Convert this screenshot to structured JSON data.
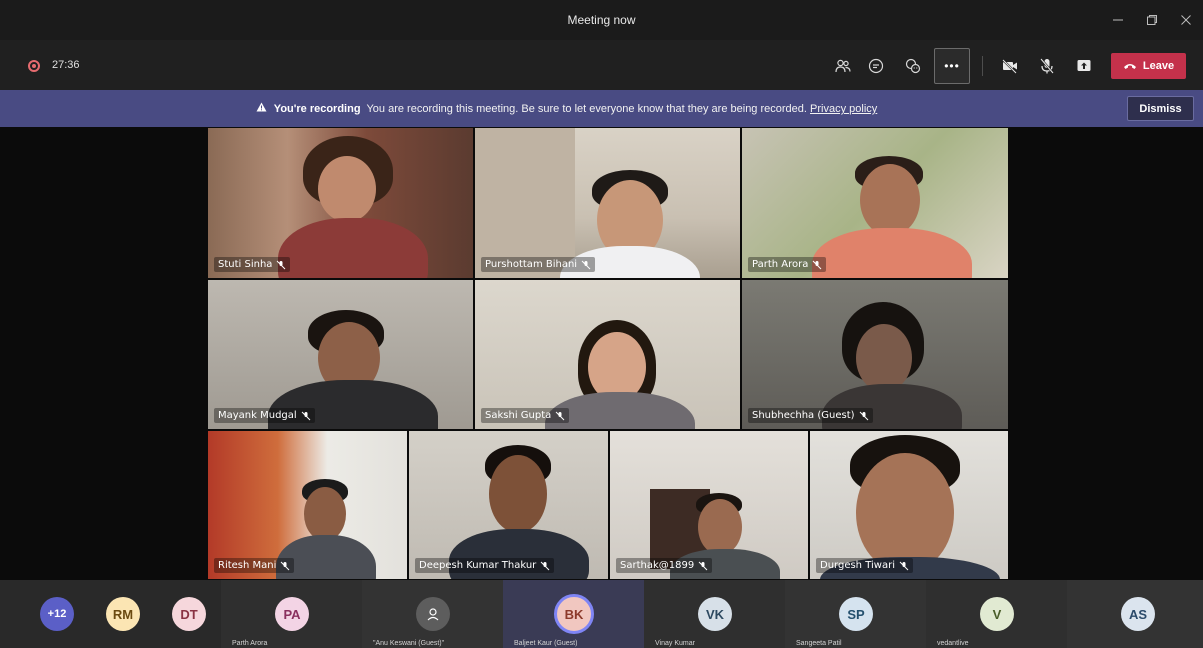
{
  "window": {
    "title": "Meeting now",
    "minimize_icon": "minimize-icon",
    "maximize_icon": "restore-icon",
    "close_icon": "close-icon"
  },
  "meeting": {
    "timer": "27:36",
    "leave_label": "Leave",
    "more_label": "•••"
  },
  "banner": {
    "title": "You're recording",
    "message": "You are recording this meeting. Be sure to let everyone know that they are being recorded.",
    "link": "Privacy policy",
    "dismiss_label": "Dismiss"
  },
  "participants": [
    {
      "name": "Stuti Sinha"
    },
    {
      "name": "Purshottam Bihani"
    },
    {
      "name": "Parth Arora"
    },
    {
      "name": "Mayank Mudgal"
    },
    {
      "name": "Sakshi Gupta"
    },
    {
      "name": "Shubhechha (Guest)"
    },
    {
      "name": "Ritesh Mani"
    },
    {
      "name": "Deepesh Kumar Thakur"
    },
    {
      "name": "Sarthak@1899"
    },
    {
      "name": "Durgesh Tiwari"
    }
  ],
  "roster": {
    "overflow": "+12",
    "initials": [
      "RM",
      "DT"
    ],
    "people": [
      {
        "initials": "PA",
        "name": "Parth Arora"
      },
      {
        "initials": "",
        "name": "\"Anu Keswani (Guest)\""
      },
      {
        "initials": "BK",
        "name": "Baljeet Kaur (Guest)"
      },
      {
        "initials": "VK",
        "name": "Vinay Kumar"
      },
      {
        "initials": "SP",
        "name": "Sangeeta Patil"
      },
      {
        "initials": "V",
        "name": "vedantlive"
      },
      {
        "initials": "AS",
        "name": ""
      }
    ]
  },
  "colors": {
    "leave": "#c4314b",
    "banner": "#494b83",
    "recording": "#e56b6f"
  }
}
